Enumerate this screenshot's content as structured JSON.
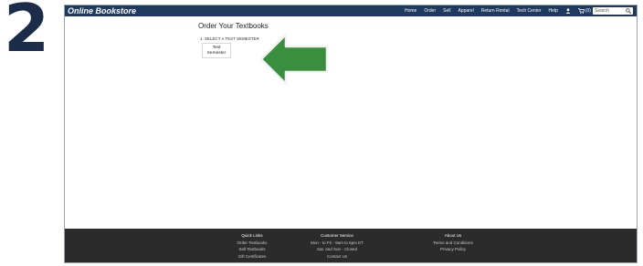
{
  "step": "2",
  "brand": "Online Bookstore",
  "nav": {
    "items": [
      "Home",
      "Order",
      "Sell",
      "Apparel",
      "Return Rental",
      "Tech Center",
      "Help"
    ],
    "cart_count": "(0)",
    "search_placeholder": "Search"
  },
  "main": {
    "title": "Order Your Textbooks",
    "step_label": "1. SELECT A TEST SEMESTER",
    "semester_line1": "Test",
    "semester_line2": "Semester"
  },
  "footer": {
    "quick_links": {
      "heading": "Quick Links",
      "items": [
        "Order Textbooks",
        "Sell Textbooks",
        "Gift Certificates"
      ]
    },
    "customer_service": {
      "heading": "Customer Service",
      "items": [
        "Mon - to Fri - 9am to 5pm ET",
        "Sat. and Sun - Closed",
        "Contact Us"
      ]
    },
    "about": {
      "heading": "About Us",
      "items": [
        "Terms and Conditions",
        "Privacy Policy"
      ]
    }
  },
  "colors": {
    "navbar": "#1e3a5f",
    "arrow": "#3a8f3e",
    "footer": "#2b2b2b"
  }
}
